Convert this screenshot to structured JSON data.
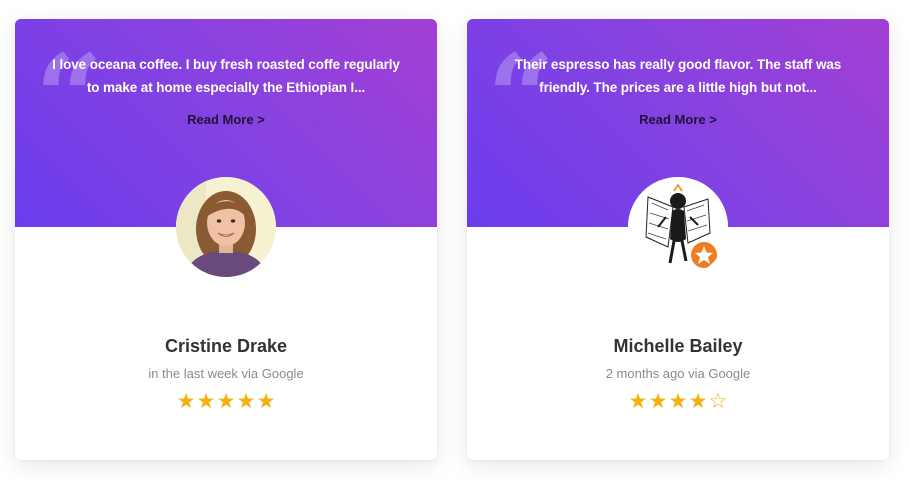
{
  "colors": {
    "gradient_start": "#6b3dee",
    "gradient_end": "#a23fd3",
    "star": "#f2b10d",
    "read_more": "#20123a"
  },
  "reviews": [
    {
      "text": "I love oceana coffee. I buy fresh roasted coffe regularly to make at home especially the Ethiopian I...",
      "read_more": "Read More >",
      "name": "Cristine Drake",
      "meta": "in the last week via Google",
      "rating": 5,
      "avatar": "photo-of-woman-avatar"
    },
    {
      "text": "Their espresso has really good flavor. The staff was friendly. The prices are a little high but not...",
      "read_more": "Read More >",
      "name": "Michelle Bailey",
      "meta": "2 months ago via Google",
      "rating": 4,
      "avatar": "cartoon-character-avatar"
    }
  ],
  "quote_icon": "quote-icon"
}
